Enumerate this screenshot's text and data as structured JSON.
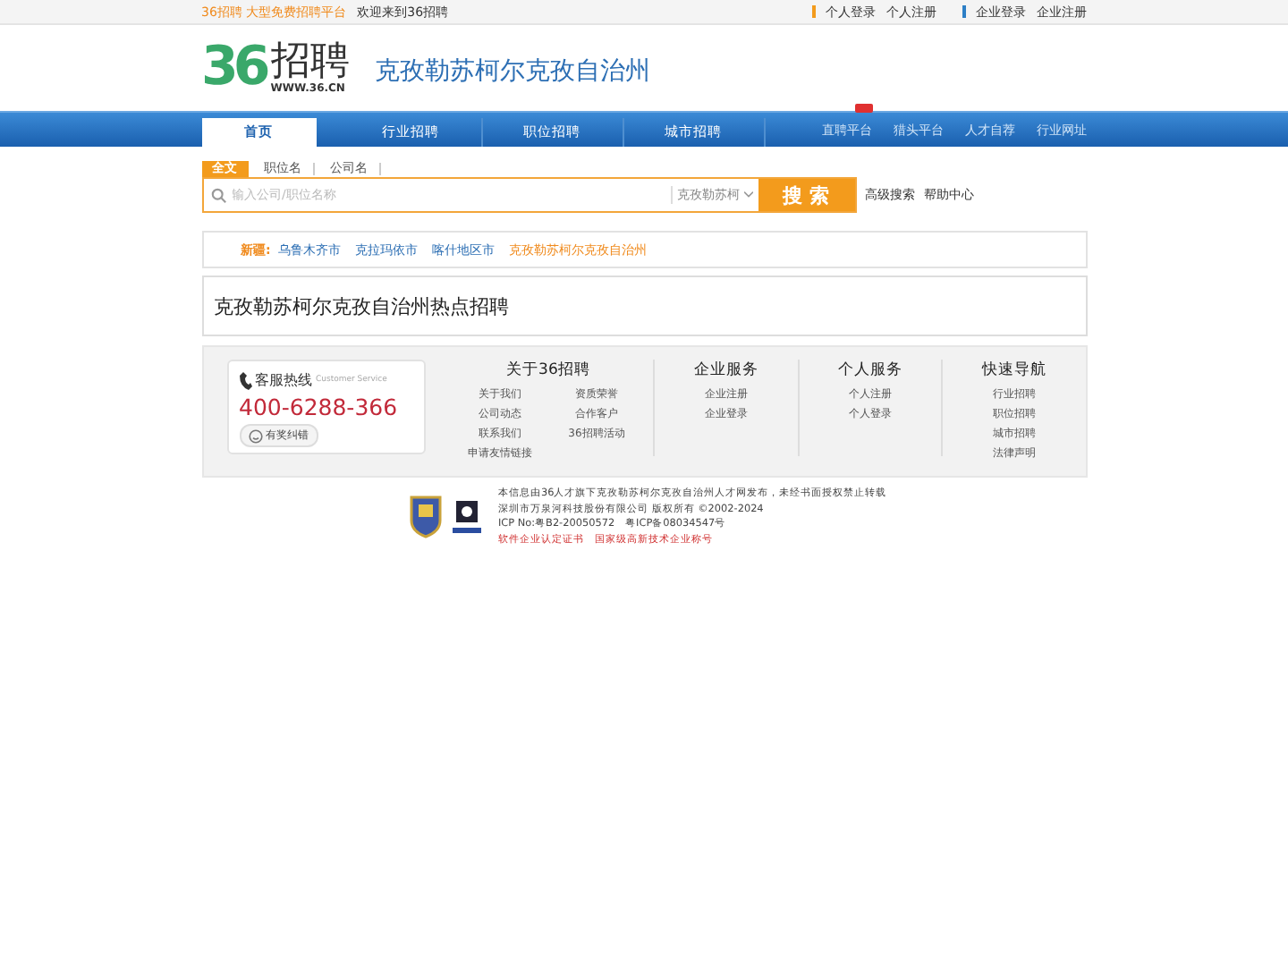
{
  "top_bar": {
    "slogan": "36招聘 大型免费招聘平台",
    "welcome": "欢迎来到36招聘",
    "personal_links": [
      "个人登录",
      "个人注册"
    ],
    "company_links": [
      "企业登录",
      "企业注册"
    ]
  },
  "header": {
    "logo_digits": "36",
    "logo_text": "招聘",
    "logo_url": "WWW.36.CN",
    "region": "克孜勒苏柯尔克孜自治州"
  },
  "nav": {
    "items": [
      {
        "label": "首页",
        "selected": true
      },
      {
        "label": "行业招聘",
        "selected": false
      },
      {
        "label": "职位招聘",
        "selected": false
      },
      {
        "label": "城市招聘",
        "selected": false
      }
    ],
    "right_links": [
      {
        "label": "直聘平台",
        "hot": true
      },
      {
        "label": "猎头平台",
        "hot": false
      },
      {
        "label": "人才自荐",
        "hot": false
      },
      {
        "label": "行业网址",
        "hot": false
      }
    ]
  },
  "search": {
    "tabs": [
      {
        "label": "全文",
        "selected": true
      },
      {
        "label": "职位名",
        "selected": false
      },
      {
        "label": "公司名",
        "selected": false
      }
    ],
    "placeholder": "输入公司/职位名称",
    "city": "克孜勒苏柯",
    "button": "搜 索",
    "links": [
      "高级搜索",
      "帮助中心"
    ]
  },
  "cities": {
    "label": "新疆:",
    "items": [
      {
        "label": "乌鲁木齐市",
        "selected": false
      },
      {
        "label": "克拉玛依市",
        "selected": false
      },
      {
        "label": "喀什地区市",
        "selected": false
      },
      {
        "label": "克孜勒苏柯尔克孜自治州",
        "selected": true
      }
    ]
  },
  "hot_title": "克孜勒苏柯尔克孜自治州热点招聘",
  "footer": {
    "hotline_label": "客服热线",
    "hotline_sub": "Customer Service",
    "phone": "400-6288-366",
    "feedback": "有奖纠错",
    "columns": [
      {
        "title": "关于36招聘",
        "links": [
          "关于我们",
          "资质荣誉",
          "公司动态",
          "合作客户",
          "联系我们",
          "36招聘活动",
          "申请友情链接"
        ]
      },
      {
        "title": "企业服务",
        "links": [
          "企业注册",
          "企业登录"
        ]
      },
      {
        "title": "个人服务",
        "links": [
          "个人注册",
          "个人登录"
        ]
      },
      {
        "title": "快速导航",
        "links": [
          "行业招聘",
          "职位招聘",
          "城市招聘",
          "法律声明"
        ]
      }
    ]
  },
  "copyright": {
    "lines": [
      "本信息由36人才旗下克孜勒苏柯尔克孜自治州人才网发布，未经书面授权禁止转载",
      "深圳市万泉河科技股份有限公司 版权所有 ©2002-2024",
      "ICP No:粤B2-20050572　粤ICP备08034547号"
    ],
    "cert_links": [
      "软件企业认定证书",
      "国家级高新技术企业称号"
    ]
  }
}
